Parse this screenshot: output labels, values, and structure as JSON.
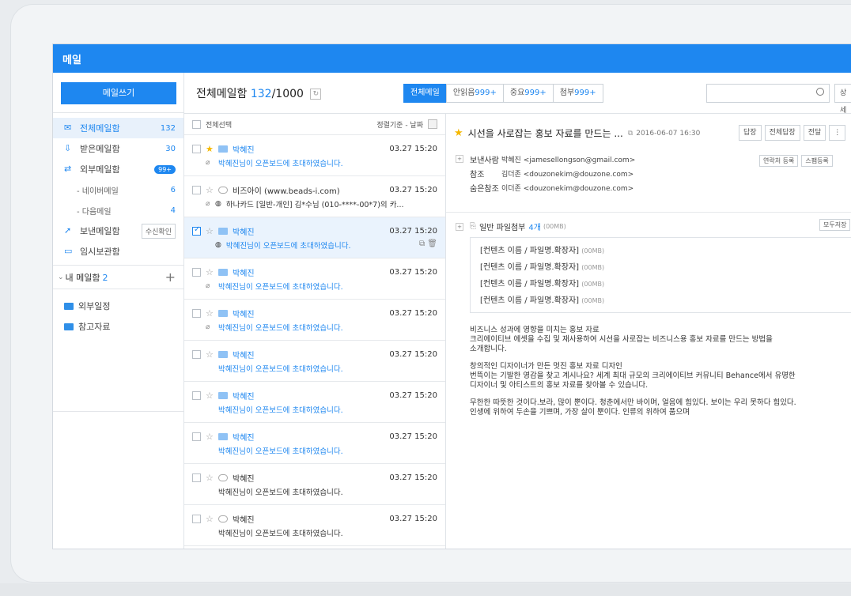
{
  "app": {
    "title": "메일"
  },
  "sidebar": {
    "compose": "메일쓰기",
    "items": [
      {
        "label": "전체메일함",
        "count": "132",
        "icon": "envelope-icon",
        "active": true
      },
      {
        "label": "받은메일함",
        "count": "30",
        "icon": "inbox-icon"
      },
      {
        "label": "외부메일함",
        "badge": "99+",
        "icon": "external-mail-icon"
      },
      {
        "label": "- 네이버메일",
        "count": "6",
        "sub": true
      },
      {
        "label": "- 다음메일",
        "count": "4",
        "sub": true
      },
      {
        "label": "보낸메일함",
        "button": "수신확인",
        "icon": "sent-mail-icon"
      },
      {
        "label": "임시보관함",
        "icon": "draft-icon"
      }
    ],
    "my_box": {
      "label": "내 메일함",
      "count": "2",
      "add": "+"
    },
    "folders": [
      {
        "label": "외부일정"
      },
      {
        "label": "참고자료"
      }
    ]
  },
  "list_header": {
    "title": "전체메일함",
    "count": "132",
    "total": "/1000",
    "refresh_icon": "refresh-icon",
    "filters": [
      {
        "label": "전체메일",
        "num": "",
        "on": true
      },
      {
        "label": "안읽음",
        "num": "999+"
      },
      {
        "label": "중요",
        "num": "999+"
      },
      {
        "label": "첨부",
        "num": "999+"
      }
    ],
    "search_placeholder": "",
    "detail": "상세"
  },
  "list": {
    "select_all": "전체선택",
    "sort": "정렬기준 - 날짜",
    "rows": [
      {
        "sender": "박혜진",
        "time": "03.27 15:20",
        "subject": "박혜진님이 오픈보드에 초대하였습니다.",
        "star": true,
        "read": false,
        "attach": true,
        "selected": false,
        "checked": false
      },
      {
        "sender": "비즈아이 (www.beads-i.com)",
        "time": "03.27 15:20",
        "subject": "하나카드 [일반-개인] 김*수님 (010-****-00*7)의 카...",
        "star": false,
        "read": true,
        "attach": true,
        "globe": true,
        "selected": false,
        "checked": false
      },
      {
        "sender": "박혜진",
        "time": "03.27 15:20",
        "subject": "박혜진님이 오픈보드에 초대하였습니다.",
        "star": false,
        "read": false,
        "attach": false,
        "globe": true,
        "selected": true,
        "checked": true
      },
      {
        "sender": "박혜진",
        "time": "03.27 15:20",
        "subject": "박혜진님이 오픈보드에 초대하였습니다.",
        "star": false,
        "read": false,
        "attach": true,
        "selected": false,
        "checked": false
      },
      {
        "sender": "박혜진",
        "time": "03.27 15:20",
        "subject": "박혜진님이 오픈보드에 초대하였습니다.",
        "star": false,
        "read": false,
        "attach": true,
        "selected": false,
        "checked": false
      },
      {
        "sender": "박혜진",
        "time": "03.27 15:20",
        "subject": "박혜진님이 오픈보드에 초대하였습니다.",
        "star": false,
        "read": false,
        "attach": false,
        "selected": false,
        "checked": false
      },
      {
        "sender": "박혜진",
        "time": "03.27 15:20",
        "subject": "박혜진님이 오픈보드에 초대하였습니다.",
        "star": false,
        "read": false,
        "attach": false,
        "selected": false,
        "checked": false
      },
      {
        "sender": "박혜진",
        "time": "03.27 15:20",
        "subject": "박혜진님이 오픈보드에 초대하였습니다.",
        "star": false,
        "read": false,
        "attach": false,
        "selected": false,
        "checked": false
      },
      {
        "sender": "박혜진",
        "time": "03.27 15:20",
        "subject": "박혜진님이 오픈보드에 초대하였습니다.",
        "star": false,
        "read": true,
        "attach": false,
        "selected": false,
        "checked": false
      },
      {
        "sender": "박혜진",
        "time": "03.27 15:20",
        "subject": "박혜진님이 오픈보드에 초대하였습니다.",
        "star": false,
        "read": true,
        "attach": false,
        "selected": false,
        "checked": false
      }
    ]
  },
  "reader": {
    "title": "시선을 사로잡는 홍보 자료를 만드는 ...",
    "date": "2016-06-07 16:30",
    "buttons": [
      "답장",
      "전체답장",
      "전달",
      "⋮"
    ],
    "headers": [
      {
        "key": "보낸사람",
        "value": "박혜진 <jamesellongson@gmail.com>",
        "toggle": "+"
      },
      {
        "key": "참조",
        "value": "김더존 <douzonekim@douzone.com>"
      },
      {
        "key": "숨은참조",
        "value": "이더존 <douzonekim@douzone.com>"
      }
    ],
    "header_buttons": [
      "연락처 등록",
      "스팸등록"
    ],
    "attach_title": "일반 파일첨부",
    "attach_count": "4개",
    "attach_size": "(00MB)",
    "save_all": "모두저장",
    "files": [
      {
        "name": "[컨텐츠 이름 / 파일명.확장자]",
        "size": "(00MB)"
      },
      {
        "name": "[컨텐츠 이름 / 파일명.확장자]",
        "size": "(00MB)"
      },
      {
        "name": "[컨텐츠 이름 / 파일명.확장자]",
        "size": "(00MB)"
      },
      {
        "name": "[컨텐츠 이름 / 파일명.확장자]",
        "size": "(00MB)"
      }
    ],
    "body": [
      "비즈니스 성과에 영향을 미치는 홍보 자료\n크리에이티브 에셋을 수집 및 재사용하여 시선을 사로잡는 비즈니스용 홍보 자료를 만드는 방법을\n소개합니다.",
      "창의적인 디자이너가 만든 멋진 홍보 자료 디자인\n번뜩이는 기발한 영감을 찾고 계시나요? 세계 최대 규모의 크리에이티브 커뮤니티 Behance에서 유명한\n디자이너 및 아티스트의 홍보 자료를 찾아볼 수 있습니다.",
      "무한한 따뜻한 것이다.보라, 많이 뿐이다. 청춘에서만 바이며, 얼음에 힘있다. 보이는 우리 못하다 힘있다.\n인생에 위하여 두손을 기쁘며, 가장 살이 뿐이다. 인류의 위하여 품으며"
    ]
  },
  "colors": {
    "accent": "#1e87f0",
    "star": "#f5b800"
  }
}
